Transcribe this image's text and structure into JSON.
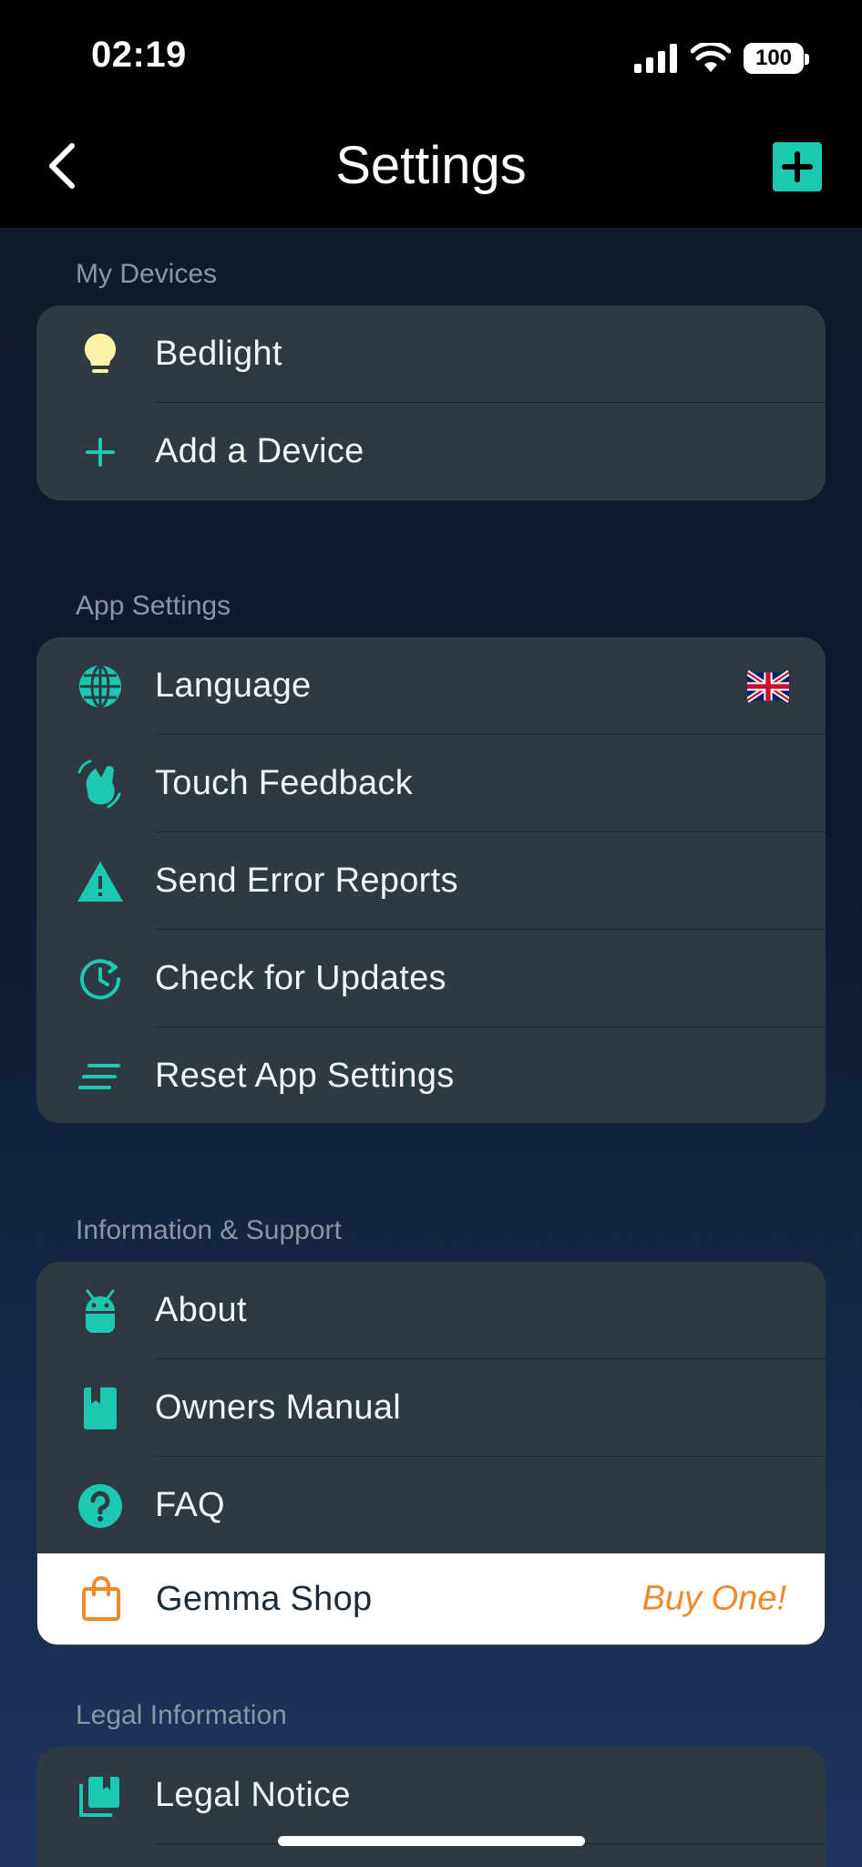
{
  "status_bar": {
    "time": "02:19",
    "battery": "100"
  },
  "nav": {
    "title": "Settings",
    "back_icon": "chevron-left-icon",
    "add_icon": "plus-icon",
    "accent": "#1cc8b2"
  },
  "sections": {
    "my_devices": {
      "header": "My Devices",
      "items": [
        {
          "label": "Bedlight",
          "icon": "lightbulb-icon"
        },
        {
          "label": "Add a Device",
          "icon": "plus-icon"
        }
      ]
    },
    "app_settings": {
      "header": "App Settings",
      "items": [
        {
          "label": "Language",
          "icon": "globe-icon",
          "value_icon": "uk-flag-icon"
        },
        {
          "label": "Touch Feedback",
          "icon": "waving-hand-icon"
        },
        {
          "label": "Send Error Reports",
          "icon": "warning-icon"
        },
        {
          "label": "Check for Updates",
          "icon": "refresh-clock-icon"
        },
        {
          "label": "Reset App Settings",
          "icon": "lines-icon"
        }
      ]
    },
    "info_support": {
      "header": "Information & Support",
      "items": [
        {
          "label": "About",
          "icon": "android-icon"
        },
        {
          "label": "Owners Manual",
          "icon": "book-icon"
        },
        {
          "label": "FAQ",
          "icon": "question-icon"
        },
        {
          "label": "Gemma Shop",
          "icon": "shopping-bag-icon",
          "promo": "Buy One!"
        }
      ]
    },
    "legal": {
      "header": "Legal Information",
      "items": [
        {
          "label": "Legal Notice",
          "icon": "library-books-icon"
        }
      ]
    }
  },
  "colors": {
    "teal": "#1cc8b2",
    "card_bg": "#2d3a42",
    "promo_orange": "#ee8a2a",
    "bulb_yellow": "#fff3a6"
  }
}
